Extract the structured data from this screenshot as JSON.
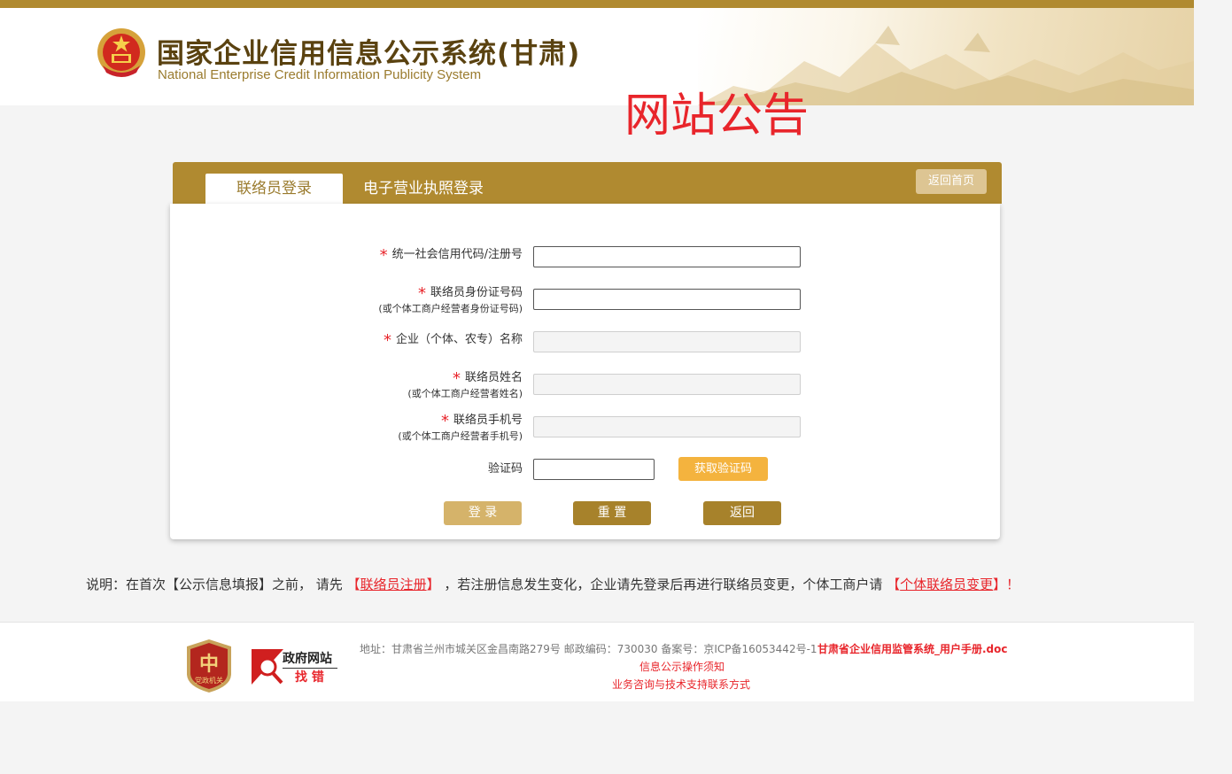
{
  "header": {
    "title_cn": "国家企业信用信息公示系统(甘肃)",
    "title_en": "National Enterprise Credit Information Publicity System"
  },
  "notice": "网站公告",
  "tabs": {
    "active": "联络员登录",
    "other": "电子营业执照登录"
  },
  "home_button": "返回首页",
  "form": {
    "fields": [
      {
        "label": "统一社会信用代码/注册号",
        "sub": "",
        "value": "",
        "enabled": true
      },
      {
        "label": "联络员身份证号码",
        "sub": "(或个体工商户经营者身份证号码)",
        "value": "",
        "enabled": true
      },
      {
        "label": "企业（个体、农专）名称",
        "sub": "",
        "value": "",
        "enabled": false
      },
      {
        "label": "联络员姓名",
        "sub": "(或个体工商户经营者姓名)",
        "value": "",
        "enabled": false
      },
      {
        "label": "联络员手机号",
        "sub": "(或个体工商户经营者手机号)",
        "value": "",
        "enabled": false
      }
    ],
    "required_mark": "*",
    "captcha_label": "验证码",
    "captcha_value": "",
    "get_code_button": "获取验证码",
    "login_button": "登 录",
    "reset_button": "重 置",
    "back_button": "返回"
  },
  "note": {
    "prefix": "说明：在首次【公示信息填报】之前，  请先 ",
    "link1_open": "【",
    "link1": "联络员注册",
    "link1_close": "】",
    "middle": " ，若注册信息发生变化，企业请先登录后再进行联络员变更，个体工商户请 ",
    "link2_open": "【",
    "link2": "个体联络员变更",
    "link2_close": "】！"
  },
  "footer": {
    "badge_text": "党政机关",
    "site_line1": "政府网站",
    "site_line2": "找 错",
    "address": "地址：甘肃省兰州市城关区金昌南路279号 邮政编码：730030 备案号：京ICP备16053442号-1",
    "manual": "甘肃省企业信用监管系统_用户手册.doc",
    "link_instructions": "信息公示操作须知",
    "link_support": "业务咨询与技术支持联系方式"
  },
  "colors": {
    "brand_gold": "#b08a30",
    "required_red": "#e8252b",
    "code_button": "#f4b33e"
  }
}
